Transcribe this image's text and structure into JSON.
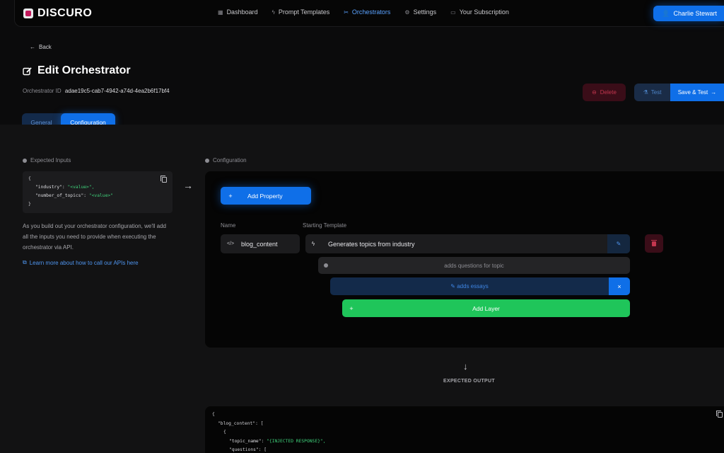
{
  "brand": {
    "name": "DISCURO"
  },
  "nav": {
    "items": [
      {
        "label": "Dashboard",
        "icon": "grid-icon"
      },
      {
        "label": "Prompt Templates",
        "icon": "bolt-icon"
      },
      {
        "label": "Orchestrators",
        "icon": "scissors-icon",
        "active": true
      },
      {
        "label": "Settings",
        "icon": "gear-icon"
      },
      {
        "label": "Your Subscription",
        "icon": "card-icon"
      }
    ],
    "user_name": "Charlie Stewart"
  },
  "header": {
    "back_label": "Back",
    "title": "Edit Orchestrator",
    "id_label": "Orchestrator ID",
    "id_value": "adae19c5-cab7-4942-a74d-4ea2b6f17bf4"
  },
  "actions": {
    "delete": "Delete",
    "test": "Test",
    "save_test": "Save & Test"
  },
  "tabs": {
    "general": "General",
    "configuration": "Configuration"
  },
  "expected_inputs": {
    "label": "Expected Inputs",
    "code": {
      "open": "{",
      "line1_key": "\"industry\":",
      "line1_val": "\"<value>\",",
      "line2_key": "\"number_of_topics\":",
      "line2_val": "\"<value>\"",
      "close": "}"
    },
    "description": "As you build out your orchestrator configuration, we'll add all the inputs you need to provide when executing the orchestrator via API.",
    "link": "Learn more about how to call our APIs here"
  },
  "configuration": {
    "label": "Configuration",
    "add_property": "Add Property",
    "name_label": "Name",
    "template_label": "Starting Template",
    "name_value": "blog_content",
    "template_value": "Generates topics from industry",
    "layers": [
      "adds questions for topic",
      "adds essays"
    ],
    "add_layer": "Add Layer"
  },
  "expected_output": {
    "label": "EXPECTED OUTPUT",
    "lines": {
      "l1": "{",
      "l2": "\"blog_content\": [",
      "l3": "{",
      "l4_key": "\"topic_name\":",
      "l4_val": "\"{INJECTED RESPONSE}\",",
      "l5": "\"questions\": ["
    }
  }
}
